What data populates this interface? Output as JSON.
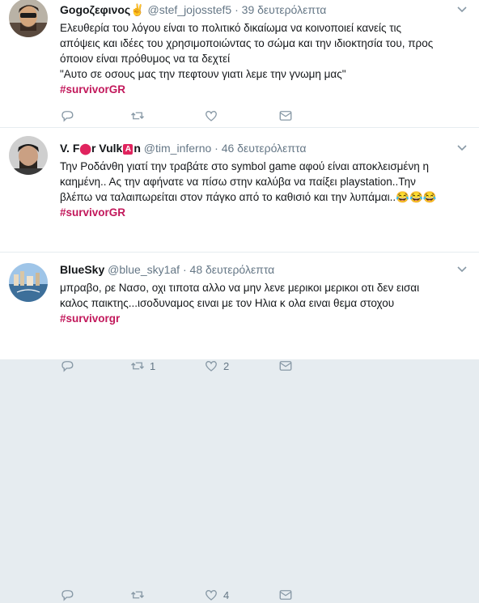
{
  "tweets": [
    {
      "name": "Gogoζεφινος",
      "name_emoji": "✌",
      "handle": "@stef_jojosstef5",
      "time": "39 δευτερόλεπτα",
      "lines": [
        "Ελευθερία του λόγου είναι το πολιτικό δικαίωμα να κοινοποιεί κανείς τις",
        "απόψεις και ιδέες του χρησιμοποιώντας το σώμα και την ιδιοκτησία του, προς",
        "όποιον είναι πρόθυμος να τα δεχτεί",
        "\"Αυτο σε οσους μας την πεφτουν γιατι λεμε την γνωμη μας\""
      ],
      "hashtag": "#survivorGR",
      "retweets": "",
      "likes": ""
    },
    {
      "name_part1": "V. F",
      "name_part2": "r Vulk",
      "name_part3": "n",
      "handle": "@tim_inferno",
      "time": "46 δευτερόλεπτα",
      "lines": [
        "Την Ροδάνθη γιατί την τραβάτε στο symbol game αφού είναι αποκλεισμένη η",
        "καημένη.. Ας την αφήνατε να πίσω στην καλύβα να παίξει playstation..Την",
        "βλέπω να ταλαιπωρείται στον πάγκο από το καθισιό και την λυπάμαι.."
      ],
      "emojis": "😂😂😂",
      "hashtag": "#survivorGR",
      "retweets": "1",
      "likes": "2"
    },
    {
      "name": "BlueSky",
      "handle": "@blue_sky1af",
      "time": "48 δευτερόλεπτα",
      "lines": [
        "μπραβο, ρε Νασο, οχι τιποτα αλλο να μην λενε μερικοι μερικοι οτι δεν εισαι",
        "καλος παικτης...ισοδυναμος ειναι με τον Ηλια κ ολα ειναι θεμα στοχου"
      ],
      "hashtag": "#survivorgr",
      "retweets": "",
      "likes": "4"
    }
  ],
  "colors": {
    "hashtag": "#c2185b",
    "muted": "#657786",
    "icon": "#8899a6",
    "emoji_box": "#e0245e"
  },
  "icons": [
    "chevron-down-icon",
    "reply-icon",
    "retweet-icon",
    "like-icon",
    "message-icon"
  ]
}
